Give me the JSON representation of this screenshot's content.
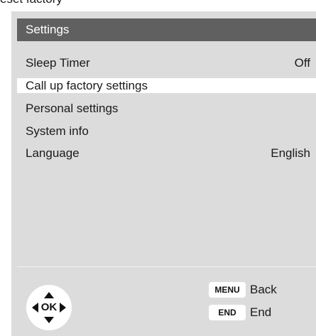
{
  "settings": {
    "title": "Settings",
    "items": [
      {
        "label": "Sleep Timer",
        "value": "Off"
      },
      {
        "label": "Call up factory settings",
        "value": ""
      },
      {
        "label": "Personal settings",
        "value": ""
      },
      {
        "label": "System info",
        "value": ""
      },
      {
        "label": "Language",
        "value": "English"
      }
    ]
  },
  "footer": {
    "ok_label": "OK",
    "menu_key": "MENU",
    "menu_action": "Back",
    "end_key": "END",
    "end_action": "End"
  }
}
